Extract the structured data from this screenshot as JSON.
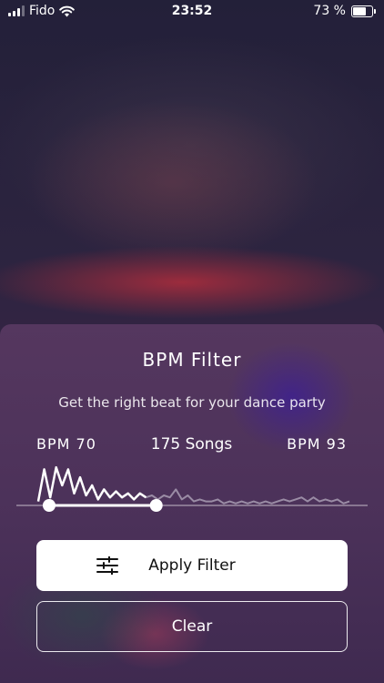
{
  "status_bar": {
    "carrier": "Fido",
    "time": "23:52",
    "battery_percent_text": "73 %",
    "battery_level": 0.73
  },
  "filter_sheet": {
    "title": "BPM Filter",
    "subtitle": "Get the right beat for your dance party",
    "min_label": "BPM 70",
    "count_label": "175 Songs",
    "max_label": "BPM 93",
    "apply_label": "Apply Filter",
    "clear_label": "Clear",
    "selected_range_fraction": [
      0.0,
      0.35
    ],
    "histogram_values": [
      0.1,
      0.9,
      0.2,
      0.95,
      0.5,
      0.9,
      0.3,
      0.7,
      0.25,
      0.5,
      0.15,
      0.4,
      0.2,
      0.35,
      0.2,
      0.3,
      0.15,
      0.3,
      0.2,
      0.25,
      0.15,
      0.25,
      0.2,
      0.4,
      0.15,
      0.25,
      0.1,
      0.15,
      0.1,
      0.1,
      0.15,
      0.05,
      0.1,
      0.05,
      0.1,
      0.05,
      0.1,
      0.05,
      0.1,
      0.05,
      0.1,
      0.15,
      0.1,
      0.15,
      0.2,
      0.1,
      0.2,
      0.1,
      0.15,
      0.1,
      0.15,
      0.05,
      0.1
    ]
  },
  "colors": {
    "sheet_bg": "#4b3159",
    "button_bg": "#ffffff",
    "selected_line": "#ffffff",
    "unselected_line": "#9a8ca5"
  }
}
